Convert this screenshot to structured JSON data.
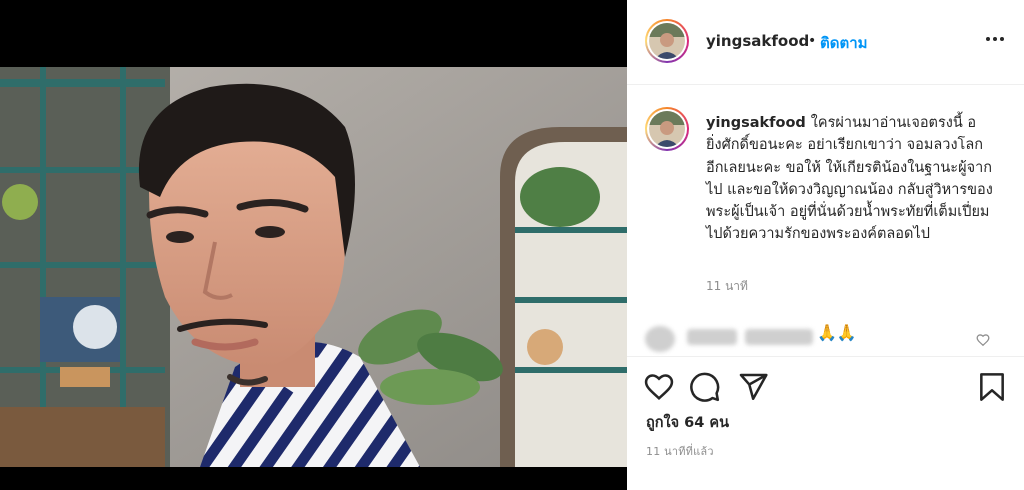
{
  "post": {
    "username": "yingsakfood",
    "follow_label": "ติดตาม",
    "separator": "•",
    "caption_username": "yingsakfood",
    "caption": "ใครผ่านมาอ่านเจอตรงนี้ อ ยิ่งศักดิ์ขอนะคะ อย่าเรียกเขาว่า จอมลวงโลกอีกเลยนะคะ ขอให้ ให้เกียรติน้องในฐานะผู้จากไป และขอให้ดวงวิญญาณน้อง กลับสู่วิหารของพระผู้เป็นเจ้า อยู่ที่นั่นด้วยน้ำพระทัยที่เต็มเปี่ยมไปด้วยความรักของพระองค์ตลอดไป",
    "caption_time": "11 นาที",
    "comment_emoji": "🙏🙏",
    "likes": "ถูกใจ 64 คน",
    "time_ago": "11 นาทีที่แล้ว"
  },
  "icons": {
    "more": "more-options-icon",
    "like": "heart-icon",
    "comment": "comment-icon",
    "share": "share-icon",
    "save": "bookmark-icon",
    "comment_like": "small-heart-icon"
  },
  "colors": {
    "accent": "#0095f6",
    "text": "#262626",
    "muted": "#8e8e8e",
    "divider": "#efefef"
  }
}
